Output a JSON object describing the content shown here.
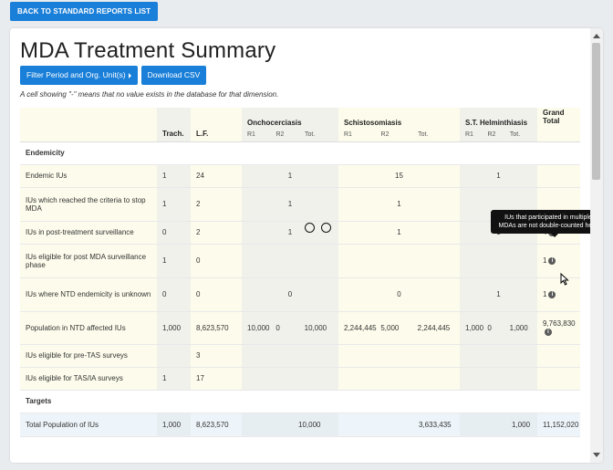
{
  "back_button": "BACK TO STANDARD REPORTS LIST",
  "title": "MDA Treatment Summary",
  "buttons": {
    "filter": "Filter Period and Org. Unit(s)",
    "download": "Download CSV"
  },
  "note": "A cell showing \"-\" means that no value exists in the database for that dimension.",
  "columns": {
    "trach": "Trach.",
    "lf": "L.F.",
    "oncho": "Onchocerciasis",
    "schisto": "Schistosomiasis",
    "sth": "S.T. Helminthiasis",
    "grand": "Grand Total",
    "sub": {
      "r1": "R1",
      "r2": "R2",
      "tot": "Tot."
    }
  },
  "sections": {
    "endemicity": "Endemicity",
    "targets": "Targets"
  },
  "rows": [
    {
      "label": "Endemic IUs",
      "trach": "1",
      "lf": "24",
      "oncho": [
        "",
        "1",
        ""
      ],
      "schisto": [
        "",
        "15",
        ""
      ],
      "sth": [
        "",
        "1",
        ""
      ],
      "grand": ""
    },
    {
      "label": "IUs which reached the criteria to stop MDA",
      "trach": "1",
      "lf": "2",
      "oncho": [
        "",
        "1",
        ""
      ],
      "schisto": [
        "",
        "1",
        ""
      ],
      "sth": [
        "",
        "",
        ""
      ],
      "grand": ""
    },
    {
      "label": "IUs in post-treatment surveillance",
      "trach": "0",
      "lf": "2",
      "oncho": [
        "",
        "1",
        ""
      ],
      "schisto": [
        "",
        "1",
        ""
      ],
      "sth": [
        "",
        "1",
        ""
      ],
      "grand": "4"
    },
    {
      "label": "IUs eligible for post MDA surveillance phase",
      "trach": "1",
      "lf": "0",
      "oncho": [
        "",
        "",
        ""
      ],
      "schisto": [
        "",
        "",
        ""
      ],
      "sth": [
        "",
        "",
        ""
      ],
      "grand": "1"
    },
    {
      "label": "IUs where NTD endemicity is unknown",
      "trach": "0",
      "lf": "0",
      "oncho": [
        "",
        "0",
        ""
      ],
      "schisto": [
        "",
        "0",
        ""
      ],
      "sth": [
        "",
        "1",
        ""
      ],
      "grand": "1"
    },
    {
      "label": "Population in NTD affected IUs",
      "trach": "1,000",
      "lf": "8,623,570",
      "oncho": [
        "10,000",
        "0",
        "10,000"
      ],
      "schisto": [
        "2,244,445",
        "5,000",
        "2,244,445"
      ],
      "sth": [
        "1,000",
        "0",
        "1,000"
      ],
      "grand": "9,763,830"
    },
    {
      "label": "IUs eligible for pre-TAS surveys",
      "trach": "",
      "lf": "3",
      "oncho": [
        "",
        "",
        ""
      ],
      "schisto": [
        "",
        "",
        ""
      ],
      "sth": [
        "",
        "",
        ""
      ],
      "grand": ""
    },
    {
      "label": "IUs eligible for TAS/IA surveys",
      "trach": "1",
      "lf": "17",
      "oncho": [
        "",
        "",
        ""
      ],
      "schisto": [
        "",
        "",
        ""
      ],
      "sth": [
        "",
        "",
        ""
      ],
      "grand": ""
    }
  ],
  "target_row": {
    "label": "Total Population of IUs",
    "trach": "1,000",
    "lf": "8,623,570",
    "oncho_tot": "10,000",
    "schisto_tot": "3,633,435",
    "sth_tot": "1,000",
    "grand": "11,152,020"
  },
  "tooltip": "IUs that participated in multiple MDAs are not double-counted here",
  "info_glyph": "i"
}
